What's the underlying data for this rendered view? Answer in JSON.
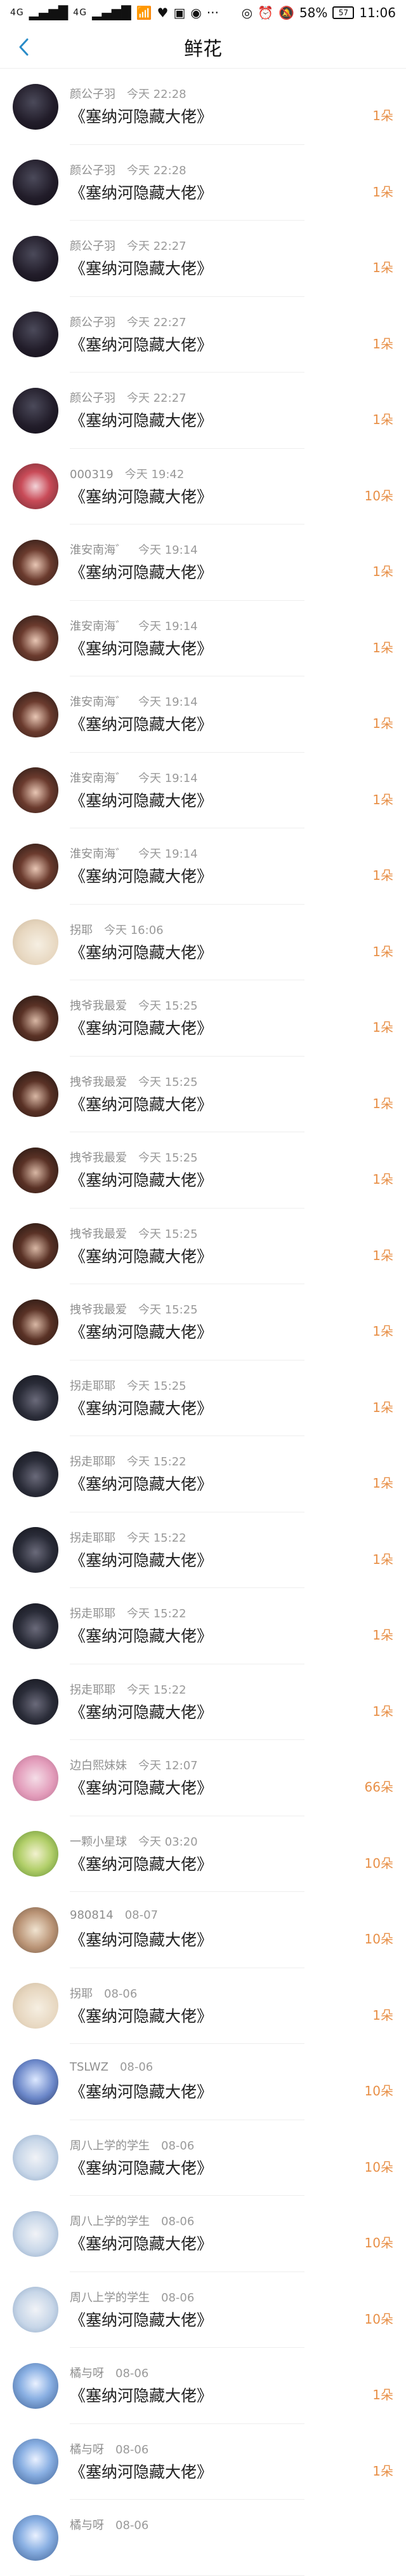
{
  "status_bar": {
    "left_signal_1": "4G",
    "left_signal_2": "4G",
    "right_battery_pct": "58%",
    "battery_box": "57",
    "time": "11:06"
  },
  "nav": {
    "title": "鲜花",
    "back_icon": "chevron-left-icon"
  },
  "rows": [
    {
      "name": "颜公子羽",
      "time": "今天 22:28",
      "book": "《塞纳河隐藏大佬》",
      "count": "1朵",
      "avatar": "av-dark"
    },
    {
      "name": "颜公子羽",
      "time": "今天 22:28",
      "book": "《塞纳河隐藏大佬》",
      "count": "1朵",
      "avatar": "av-dark"
    },
    {
      "name": "颜公子羽",
      "time": "今天 22:27",
      "book": "《塞纳河隐藏大佬》",
      "count": "1朵",
      "avatar": "av-dark"
    },
    {
      "name": "颜公子羽",
      "time": "今天 22:27",
      "book": "《塞纳河隐藏大佬》",
      "count": "1朵",
      "avatar": "av-dark"
    },
    {
      "name": "颜公子羽",
      "time": "今天 22:27",
      "book": "《塞纳河隐藏大佬》",
      "count": "1朵",
      "avatar": "av-dark"
    },
    {
      "name": "000319",
      "time": "今天 19:42",
      "book": "《塞纳河隐藏大佬》",
      "count": "10朵",
      "avatar": "av-colorful"
    },
    {
      "name": "淮安南海゛",
      "time": "今天 19:14",
      "book": "《塞纳河隐藏大佬》",
      "count": "1朵",
      "avatar": "av-girl"
    },
    {
      "name": "淮安南海゛",
      "time": "今天 19:14",
      "book": "《塞纳河隐藏大佬》",
      "count": "1朵",
      "avatar": "av-girl"
    },
    {
      "name": "淮安南海゛",
      "time": "今天 19:14",
      "book": "《塞纳河隐藏大佬》",
      "count": "1朵",
      "avatar": "av-girl"
    },
    {
      "name": "淮安南海゛",
      "time": "今天 19:14",
      "book": "《塞纳河隐藏大佬》",
      "count": "1朵",
      "avatar": "av-girl"
    },
    {
      "name": "淮安南海゛",
      "time": "今天 19:14",
      "book": "《塞纳河隐藏大佬》",
      "count": "1朵",
      "avatar": "av-girl"
    },
    {
      "name": "拐耶",
      "time": "今天 16:06",
      "book": "《塞纳河隐藏大佬》",
      "count": "1朵",
      "avatar": "av-cream"
    },
    {
      "name": "拽爷我最爱",
      "time": "今天 15:25",
      "book": "《塞纳河隐藏大佬》",
      "count": "1朵",
      "avatar": "av-glasses"
    },
    {
      "name": "拽爷我最爱",
      "time": "今天 15:25",
      "book": "《塞纳河隐藏大佬》",
      "count": "1朵",
      "avatar": "av-glasses"
    },
    {
      "name": "拽爷我最爱",
      "time": "今天 15:25",
      "book": "《塞纳河隐藏大佬》",
      "count": "1朵",
      "avatar": "av-glasses"
    },
    {
      "name": "拽爷我最爱",
      "time": "今天 15:25",
      "book": "《塞纳河隐藏大佬》",
      "count": "1朵",
      "avatar": "av-glasses"
    },
    {
      "name": "拽爷我最爱",
      "time": "今天 15:25",
      "book": "《塞纳河隐藏大佬》",
      "count": "1朵",
      "avatar": "av-glasses"
    },
    {
      "name": "拐走耶耶",
      "time": "今天 15:25",
      "book": "《塞纳河隐藏大佬》",
      "count": "1朵",
      "avatar": "av-mask"
    },
    {
      "name": "拐走耶耶",
      "time": "今天 15:22",
      "book": "《塞纳河隐藏大佬》",
      "count": "1朵",
      "avatar": "av-mask"
    },
    {
      "name": "拐走耶耶",
      "time": "今天 15:22",
      "book": "《塞纳河隐藏大佬》",
      "count": "1朵",
      "avatar": "av-mask"
    },
    {
      "name": "拐走耶耶",
      "time": "今天 15:22",
      "book": "《塞纳河隐藏大佬》",
      "count": "1朵",
      "avatar": "av-mask"
    },
    {
      "name": "拐走耶耶",
      "time": "今天 15:22",
      "book": "《塞纳河隐藏大佬》",
      "count": "1朵",
      "avatar": "av-mask"
    },
    {
      "name": "边白熙妹妹",
      "time": "今天 12:07",
      "book": "《塞纳河隐藏大佬》",
      "count": "66朵",
      "avatar": "av-pink"
    },
    {
      "name": "一颗小星球",
      "time": "今天 03:20",
      "book": "《塞纳河隐藏大佬》",
      "count": "10朵",
      "avatar": "av-green"
    },
    {
      "name": "980814",
      "time": "08-07",
      "book": "《塞纳河隐藏大佬》",
      "count": "10朵",
      "avatar": "av-brown"
    },
    {
      "name": "拐耶",
      "time": "08-06",
      "book": "《塞纳河隐藏大佬》",
      "count": "1朵",
      "avatar": "av-cream"
    },
    {
      "name": "TSLWZ",
      "time": "08-06",
      "book": "《塞纳河隐藏大佬》",
      "count": "10朵",
      "avatar": "av-blue"
    },
    {
      "name": "周八上学的学生",
      "time": "08-06",
      "book": "《塞纳河隐藏大佬》",
      "count": "10朵",
      "avatar": "av-student"
    },
    {
      "name": "周八上学的学生",
      "time": "08-06",
      "book": "《塞纳河隐藏大佬》",
      "count": "10朵",
      "avatar": "av-student"
    },
    {
      "name": "周八上学的学生",
      "time": "08-06",
      "book": "《塞纳河隐藏大佬》",
      "count": "10朵",
      "avatar": "av-student"
    },
    {
      "name": "橘与呀",
      "time": "08-06",
      "book": "《塞纳河隐藏大佬》",
      "count": "1朵",
      "avatar": "av-blueh"
    },
    {
      "name": "橘与呀",
      "time": "08-06",
      "book": "《塞纳河隐藏大佬》",
      "count": "1朵",
      "avatar": "av-blueh"
    },
    {
      "name": "橘与呀",
      "time": "08-06",
      "book": "",
      "count": "",
      "avatar": "av-blueh"
    }
  ]
}
